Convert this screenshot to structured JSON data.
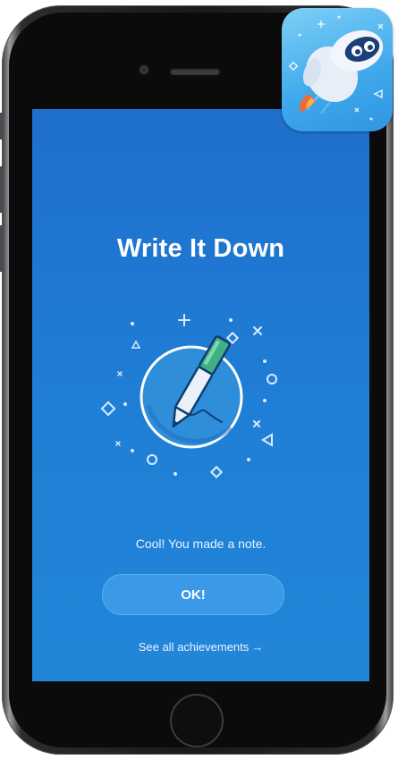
{
  "screen": {
    "title": "Write It Down",
    "message": "Cool! You made a note.",
    "ok_label": "OK!",
    "see_all_label": "See all achievements",
    "see_all_arrow": "→"
  },
  "icons": {
    "achievement": "pen-writing-icon",
    "app": "rocket-mascot-app-icon"
  },
  "colors": {
    "screen_top": "#1f6fcc",
    "screen_bottom": "#2186d8",
    "button_fill": "#3a9ae8",
    "pen_cap": "#3fb083"
  }
}
